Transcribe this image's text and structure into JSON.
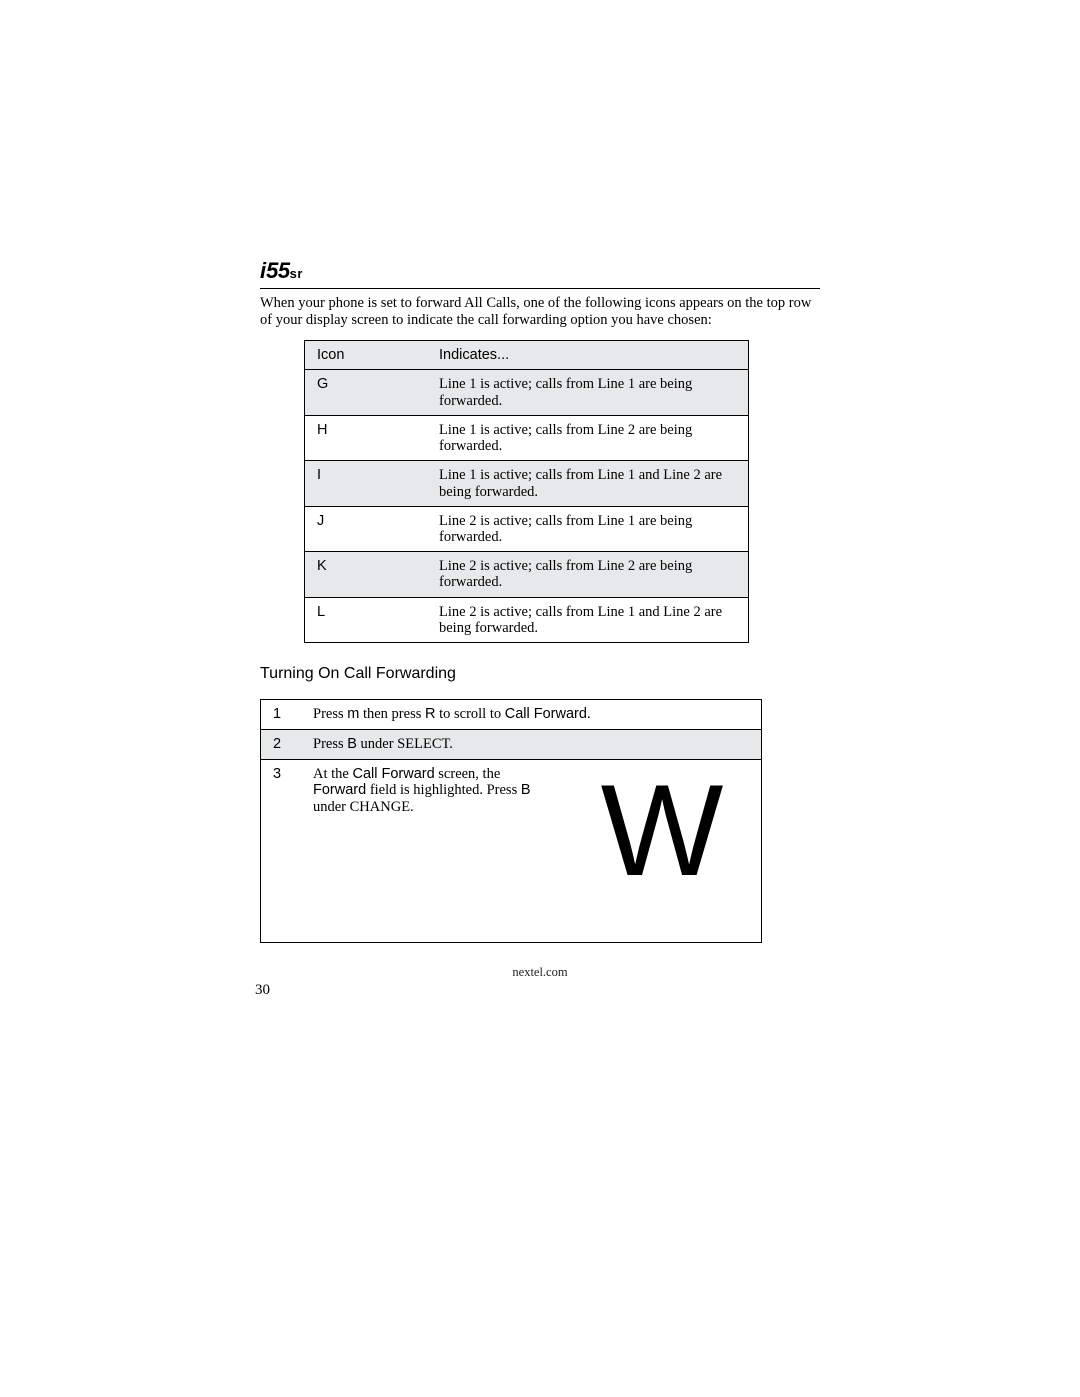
{
  "header": {
    "model_i": "i",
    "model_num": "55",
    "model_sr": "sr"
  },
  "intro": "When your phone is set to forward All Calls, one of the following icons appears on the top row of your display screen to indicate the call forwarding option you have chosen:",
  "icon_table": {
    "head_icon": "Icon",
    "head_indicates": "Indicates...",
    "rows": [
      {
        "icon": "G",
        "desc": "Line 1 is active; calls from Line 1 are being forwarded."
      },
      {
        "icon": "H",
        "desc": "Line 1 is active; calls from Line 2 are being forwarded."
      },
      {
        "icon": "I",
        "desc": "Line 1 is active; calls from Line 1 and Line 2 are being forwarded."
      },
      {
        "icon": "J",
        "desc": "Line 2 is active; calls from Line 1 are being forwarded."
      },
      {
        "icon": "K",
        "desc": "Line 2 is active; calls from Line 2 are being forwarded."
      },
      {
        "icon": "L",
        "desc": "Line 2 is active; calls from Line 1 and Line 2 are being forwarded."
      }
    ]
  },
  "section_heading": "Turning On Call Forwarding",
  "steps": {
    "s1": {
      "num": "1",
      "t1": "Press ",
      "k1": "m",
      "t2": " then press ",
      "k2": "R",
      "t3": " to scroll to ",
      "bold": "Call Forward",
      "t4": "."
    },
    "s2": {
      "num": "2",
      "t1": "Press ",
      "k1": "B",
      "t2": " under SELECT."
    },
    "s3": {
      "num": "3",
      "t1": "At the ",
      "b1": "Call Forward",
      "t2": " screen, the ",
      "b2": "Forward",
      "t3": " field is highlighted. Press ",
      "k1": "B",
      "t4": " under CHANGE.",
      "graphic": "W"
    }
  },
  "footer_url": "nextel.com",
  "page_number": "30"
}
